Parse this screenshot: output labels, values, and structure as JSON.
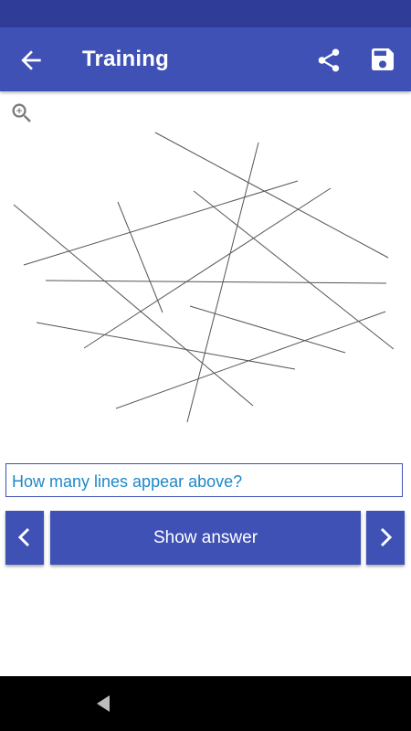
{
  "app_bar": {
    "title": "Training",
    "back_icon": "arrow-left-icon",
    "share_icon": "share-icon",
    "save_icon": "save-icon"
  },
  "canvas": {
    "zoom_icon": "zoom-in-icon",
    "line_color": "#555555"
  },
  "question": {
    "text": "How many lines appear above?"
  },
  "controls": {
    "prev_icon": "chevron-left-icon",
    "show_answer_label": "Show answer",
    "next_icon": "chevron-right-icon"
  },
  "system_nav": {
    "back_icon": "triangle-back-icon"
  },
  "colors": {
    "primary": "#3f51b5",
    "primary_dark": "#2f3d98",
    "question_text": "#1e88c8"
  }
}
